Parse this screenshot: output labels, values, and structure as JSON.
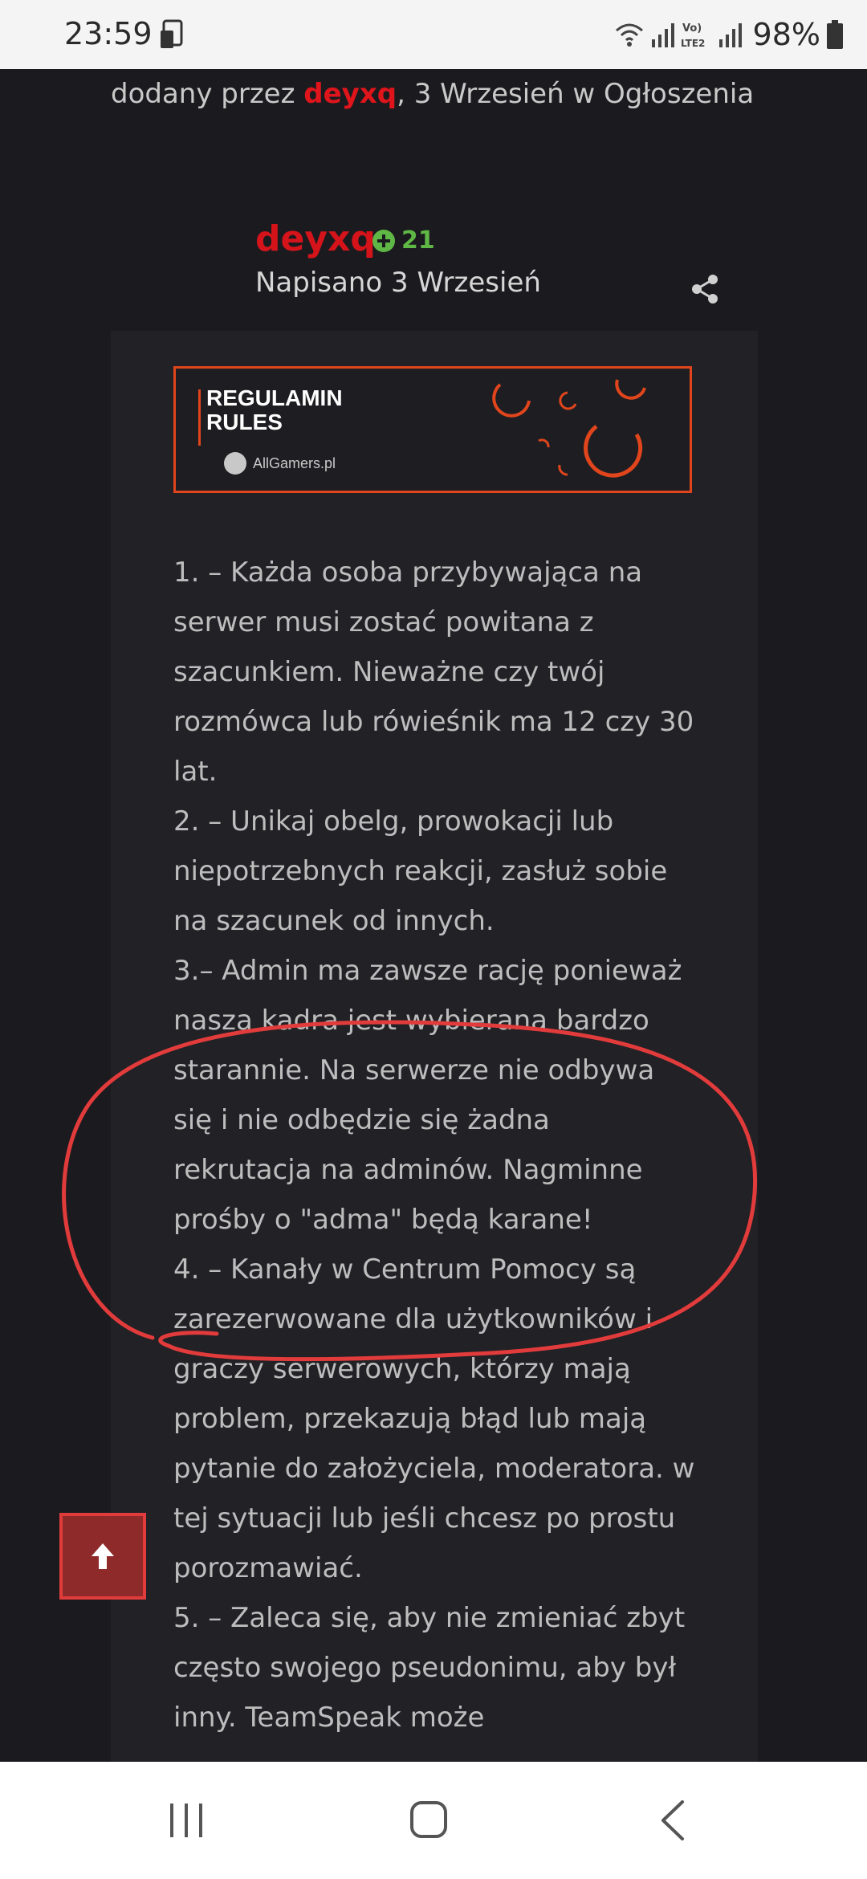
{
  "status_bar": {
    "time": "23:59",
    "battery": "98%",
    "network_label": "VoLTE2"
  },
  "post_meta": {
    "prefix": "dodany przez ",
    "author": "deyxq",
    "suffix": ", 3 Wrzesień w Ogłoszenia"
  },
  "post": {
    "author": "deyxq",
    "reputation": "21",
    "date": "Napisano 3 Wrzesień"
  },
  "banner": {
    "line1": "REGULAMIN",
    "line2": "RULES",
    "brand": "AllGamers.pl"
  },
  "rules": [
    "1. – Każda osoba przybywająca na serwer musi zostać powitana z szacunkiem. Nieważne czy twój rozmówca lub rówieśnik ma 12 czy 30 lat.",
    "2. – Unikaj obelg, prowokacji lub niepotrzebnych reakcji, zasłuż sobie na szacunek od innych.",
    "3.– Admin ma zawsze rację ponieważ nasza kadra jest wybierana bardzo starannie. Na serwerze nie odbywa się i nie odbędzie się żadna rekrutacja na adminów. Nagminne prośby o \"adma\" będą karane!",
    "4. – Kanały w Centrum Pomocy są zarezerwowane dla użytkowników i graczy serwerowych, którzy mają problem, przekazują błąd lub mają pytanie do założyciela, moderatora. w tej sytuacji lub jeśli chcesz po prostu porozmawiać.",
    "5. – Zaleca się, aby nie zmieniać zbyt często swojego pseudonimu, aby był inny. TeamSpeak może"
  ],
  "colors": {
    "accent_red": "#d4141a",
    "reputation_green": "#5fb845",
    "banner_orange": "#e0451c",
    "annotation_red": "#e23b3b"
  },
  "icons": {
    "share": "share-icon",
    "scroll_top": "arrow-up-icon",
    "nav_recents": "recents-icon",
    "nav_home": "home-icon",
    "nav_back": "back-icon"
  }
}
